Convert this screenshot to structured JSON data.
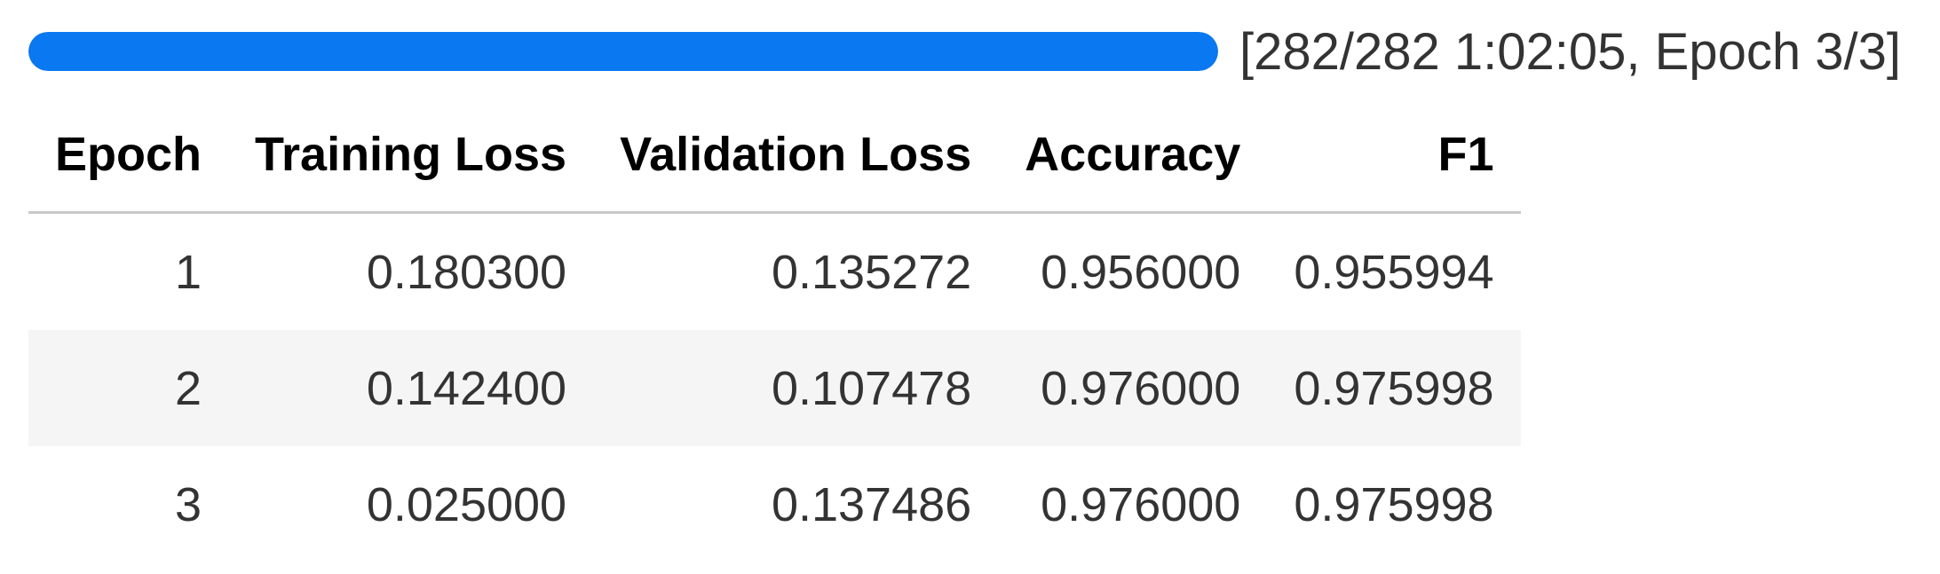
{
  "progress": {
    "fraction": 1.0,
    "label": "[282/282 1:02:05, Epoch 3/3]",
    "color": "#0a78f0"
  },
  "table": {
    "columns": [
      "Epoch",
      "Training Loss",
      "Validation Loss",
      "Accuracy",
      "F1"
    ],
    "rows": [
      [
        "1",
        "0.180300",
        "0.135272",
        "0.956000",
        "0.955994"
      ],
      [
        "2",
        "0.142400",
        "0.107478",
        "0.976000",
        "0.975998"
      ],
      [
        "3",
        "0.025000",
        "0.137486",
        "0.976000",
        "0.975998"
      ]
    ]
  }
}
